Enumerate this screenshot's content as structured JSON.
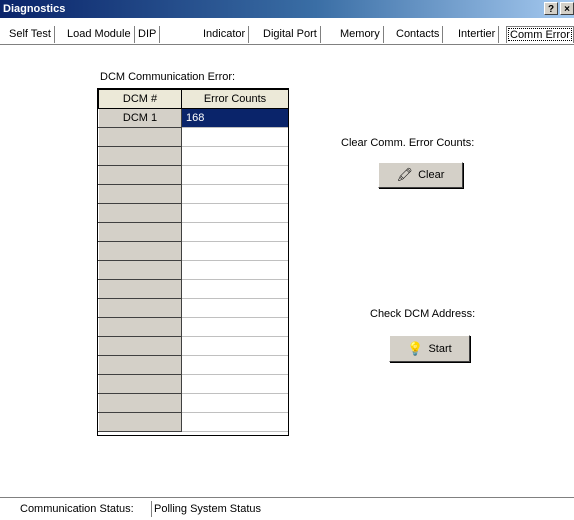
{
  "window": {
    "title": "Diagnostics",
    "help_button": "?",
    "close_button": "×"
  },
  "tabs": [
    {
      "label": "Self Test"
    },
    {
      "label": "Load Module"
    },
    {
      "label": "DIP"
    },
    {
      "label": "Indicator"
    },
    {
      "label": "Digital Port"
    },
    {
      "label": "Memory"
    },
    {
      "label": "Contacts"
    },
    {
      "label": "Intertier"
    },
    {
      "label": "Comm Error",
      "active": true
    }
  ],
  "error_panel": {
    "title": "DCM Communication Error:",
    "columns": [
      "DCM #",
      "Error Counts"
    ],
    "rows": [
      {
        "dcm": "DCM 1",
        "count": "168",
        "selected": true
      },
      {
        "dcm": "",
        "count": ""
      },
      {
        "dcm": "",
        "count": ""
      },
      {
        "dcm": "",
        "count": ""
      },
      {
        "dcm": "",
        "count": ""
      },
      {
        "dcm": "",
        "count": ""
      },
      {
        "dcm": "",
        "count": ""
      },
      {
        "dcm": "",
        "count": ""
      },
      {
        "dcm": "",
        "count": ""
      },
      {
        "dcm": "",
        "count": ""
      },
      {
        "dcm": "",
        "count": ""
      },
      {
        "dcm": "",
        "count": ""
      },
      {
        "dcm": "",
        "count": ""
      },
      {
        "dcm": "",
        "count": ""
      },
      {
        "dcm": "",
        "count": ""
      },
      {
        "dcm": "",
        "count": ""
      },
      {
        "dcm": "",
        "count": ""
      }
    ]
  },
  "clear_section": {
    "label": "Clear Comm. Error Counts:",
    "button": "Clear",
    "icon": "eraser-icon"
  },
  "check_section": {
    "label": "Check DCM Address:",
    "button": "Start",
    "icon": "lightbulb-icon"
  },
  "status": {
    "label": "Communication Status:",
    "value": "Polling System Status"
  }
}
